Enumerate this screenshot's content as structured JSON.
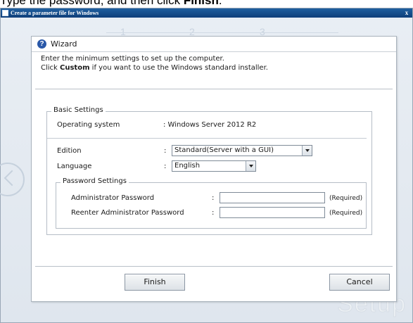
{
  "instruction": {
    "prefix": "Type the password, and then click ",
    "bold": "Finish",
    "suffix": "."
  },
  "window": {
    "title": "Create a parameter file for Windows",
    "close_glyph": "x"
  },
  "background": {
    "step_marks": [
      "1",
      "2",
      "3"
    ],
    "brand_text": "Setup"
  },
  "wizard": {
    "title": "Wizard",
    "intro_line1": "Enter the minimum settings to set up the computer.",
    "intro_line2_prefix": "Click ",
    "intro_line2_bold": "Custom",
    "intro_line2_suffix": " if you want to use the Windows standard installer."
  },
  "basic_settings": {
    "legend": "Basic Settings",
    "os_label": "Operating system",
    "os_value": ":  Windows Server 2012 R2",
    "edition_label": "Edition",
    "edition_colon": ":",
    "edition_value": "Standard(Server with a GUI)",
    "language_label": "Language",
    "language_colon": ":",
    "language_value": "English"
  },
  "password_settings": {
    "legend": "Password Settings",
    "admin_label": "Administrator Password",
    "admin_colon": ":",
    "admin_value": "",
    "reenter_label": "Reenter Administrator Password",
    "reenter_colon": ":",
    "reenter_value": "",
    "required_text": "(Required)"
  },
  "buttons": {
    "finish": "Finish",
    "cancel": "Cancel"
  }
}
